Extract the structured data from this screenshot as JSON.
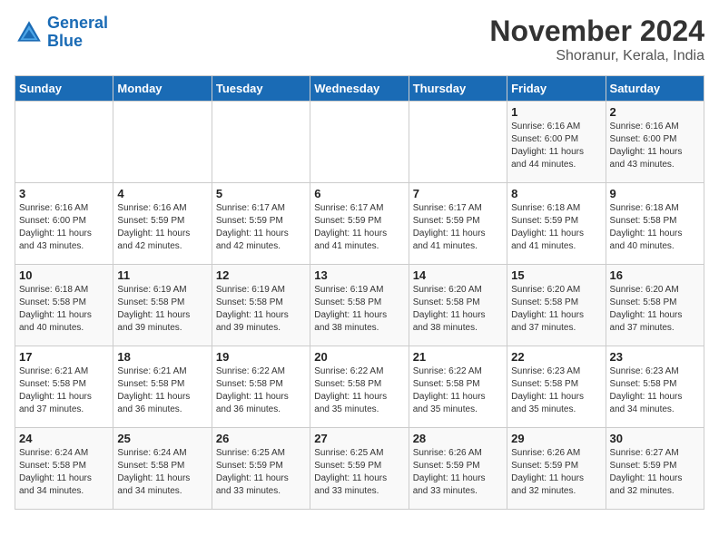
{
  "header": {
    "logo_line1": "General",
    "logo_line2": "Blue",
    "month": "November 2024",
    "location": "Shoranur, Kerala, India"
  },
  "weekdays": [
    "Sunday",
    "Monday",
    "Tuesday",
    "Wednesday",
    "Thursday",
    "Friday",
    "Saturday"
  ],
  "weeks": [
    [
      {
        "day": "",
        "info": ""
      },
      {
        "day": "",
        "info": ""
      },
      {
        "day": "",
        "info": ""
      },
      {
        "day": "",
        "info": ""
      },
      {
        "day": "",
        "info": ""
      },
      {
        "day": "1",
        "info": "Sunrise: 6:16 AM\nSunset: 6:00 PM\nDaylight: 11 hours\nand 44 minutes."
      },
      {
        "day": "2",
        "info": "Sunrise: 6:16 AM\nSunset: 6:00 PM\nDaylight: 11 hours\nand 43 minutes."
      }
    ],
    [
      {
        "day": "3",
        "info": "Sunrise: 6:16 AM\nSunset: 6:00 PM\nDaylight: 11 hours\nand 43 minutes."
      },
      {
        "day": "4",
        "info": "Sunrise: 6:16 AM\nSunset: 5:59 PM\nDaylight: 11 hours\nand 42 minutes."
      },
      {
        "day": "5",
        "info": "Sunrise: 6:17 AM\nSunset: 5:59 PM\nDaylight: 11 hours\nand 42 minutes."
      },
      {
        "day": "6",
        "info": "Sunrise: 6:17 AM\nSunset: 5:59 PM\nDaylight: 11 hours\nand 41 minutes."
      },
      {
        "day": "7",
        "info": "Sunrise: 6:17 AM\nSunset: 5:59 PM\nDaylight: 11 hours\nand 41 minutes."
      },
      {
        "day": "8",
        "info": "Sunrise: 6:18 AM\nSunset: 5:59 PM\nDaylight: 11 hours\nand 41 minutes."
      },
      {
        "day": "9",
        "info": "Sunrise: 6:18 AM\nSunset: 5:58 PM\nDaylight: 11 hours\nand 40 minutes."
      }
    ],
    [
      {
        "day": "10",
        "info": "Sunrise: 6:18 AM\nSunset: 5:58 PM\nDaylight: 11 hours\nand 40 minutes."
      },
      {
        "day": "11",
        "info": "Sunrise: 6:19 AM\nSunset: 5:58 PM\nDaylight: 11 hours\nand 39 minutes."
      },
      {
        "day": "12",
        "info": "Sunrise: 6:19 AM\nSunset: 5:58 PM\nDaylight: 11 hours\nand 39 minutes."
      },
      {
        "day": "13",
        "info": "Sunrise: 6:19 AM\nSunset: 5:58 PM\nDaylight: 11 hours\nand 38 minutes."
      },
      {
        "day": "14",
        "info": "Sunrise: 6:20 AM\nSunset: 5:58 PM\nDaylight: 11 hours\nand 38 minutes."
      },
      {
        "day": "15",
        "info": "Sunrise: 6:20 AM\nSunset: 5:58 PM\nDaylight: 11 hours\nand 37 minutes."
      },
      {
        "day": "16",
        "info": "Sunrise: 6:20 AM\nSunset: 5:58 PM\nDaylight: 11 hours\nand 37 minutes."
      }
    ],
    [
      {
        "day": "17",
        "info": "Sunrise: 6:21 AM\nSunset: 5:58 PM\nDaylight: 11 hours\nand 37 minutes."
      },
      {
        "day": "18",
        "info": "Sunrise: 6:21 AM\nSunset: 5:58 PM\nDaylight: 11 hours\nand 36 minutes."
      },
      {
        "day": "19",
        "info": "Sunrise: 6:22 AM\nSunset: 5:58 PM\nDaylight: 11 hours\nand 36 minutes."
      },
      {
        "day": "20",
        "info": "Sunrise: 6:22 AM\nSunset: 5:58 PM\nDaylight: 11 hours\nand 35 minutes."
      },
      {
        "day": "21",
        "info": "Sunrise: 6:22 AM\nSunset: 5:58 PM\nDaylight: 11 hours\nand 35 minutes."
      },
      {
        "day": "22",
        "info": "Sunrise: 6:23 AM\nSunset: 5:58 PM\nDaylight: 11 hours\nand 35 minutes."
      },
      {
        "day": "23",
        "info": "Sunrise: 6:23 AM\nSunset: 5:58 PM\nDaylight: 11 hours\nand 34 minutes."
      }
    ],
    [
      {
        "day": "24",
        "info": "Sunrise: 6:24 AM\nSunset: 5:58 PM\nDaylight: 11 hours\nand 34 minutes."
      },
      {
        "day": "25",
        "info": "Sunrise: 6:24 AM\nSunset: 5:58 PM\nDaylight: 11 hours\nand 34 minutes."
      },
      {
        "day": "26",
        "info": "Sunrise: 6:25 AM\nSunset: 5:59 PM\nDaylight: 11 hours\nand 33 minutes."
      },
      {
        "day": "27",
        "info": "Sunrise: 6:25 AM\nSunset: 5:59 PM\nDaylight: 11 hours\nand 33 minutes."
      },
      {
        "day": "28",
        "info": "Sunrise: 6:26 AM\nSunset: 5:59 PM\nDaylight: 11 hours\nand 33 minutes."
      },
      {
        "day": "29",
        "info": "Sunrise: 6:26 AM\nSunset: 5:59 PM\nDaylight: 11 hours\nand 32 minutes."
      },
      {
        "day": "30",
        "info": "Sunrise: 6:27 AM\nSunset: 5:59 PM\nDaylight: 11 hours\nand 32 minutes."
      }
    ]
  ]
}
